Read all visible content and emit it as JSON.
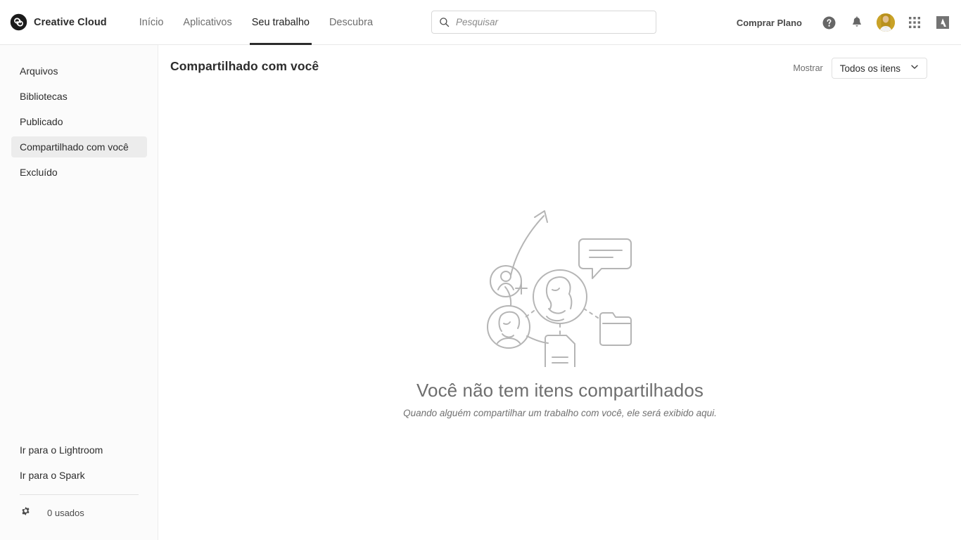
{
  "header": {
    "brand": "Creative Cloud",
    "logo_icon": "creative-cloud-logo",
    "nav": [
      {
        "label": "Início",
        "active": false
      },
      {
        "label": "Aplicativos",
        "active": false
      },
      {
        "label": "Seu trabalho",
        "active": true
      },
      {
        "label": "Descubra",
        "active": false
      }
    ],
    "search": {
      "placeholder": "Pesquisar",
      "value": "",
      "icon": "search-icon"
    },
    "buy_plan_label": "Comprar Plano",
    "icons": [
      "help-icon",
      "notification-bell-icon",
      "avatar",
      "app-grid-icon",
      "adobe-logo-icon"
    ]
  },
  "sidebar": {
    "items": [
      {
        "label": "Arquivos",
        "selected": false
      },
      {
        "label": "Bibliotecas",
        "selected": false
      },
      {
        "label": "Publicado",
        "selected": false
      },
      {
        "label": "Compartilhado com você",
        "selected": true
      },
      {
        "label": "Excluído",
        "selected": false
      }
    ],
    "links": [
      {
        "label": "Ir para o Lightroom"
      },
      {
        "label": "Ir para o Spark"
      }
    ],
    "storage": {
      "icon": "gear-icon",
      "label": "0 usados"
    }
  },
  "main": {
    "title": "Compartilhado com você",
    "filter": {
      "label": "Mostrar",
      "selected": "Todos os itens",
      "options": [
        "Todos os itens"
      ],
      "chevron_icon": "chevron-down-icon"
    },
    "empty_state": {
      "illustration": "collaboration-empty-illustration",
      "title": "Você não tem itens compartilhados",
      "subtitle": "Quando alguém compartilhar um trabalho com você, ele será exibido aqui."
    }
  },
  "colors": {
    "accent_dark": "#2c2c2c",
    "sidebar_bg": "#fbfbfb",
    "selected_bg": "#ececec",
    "muted_text": "#6e6e6e",
    "illustration_stroke": "#b5b5b5",
    "avatar_bg": "#c9a227"
  }
}
